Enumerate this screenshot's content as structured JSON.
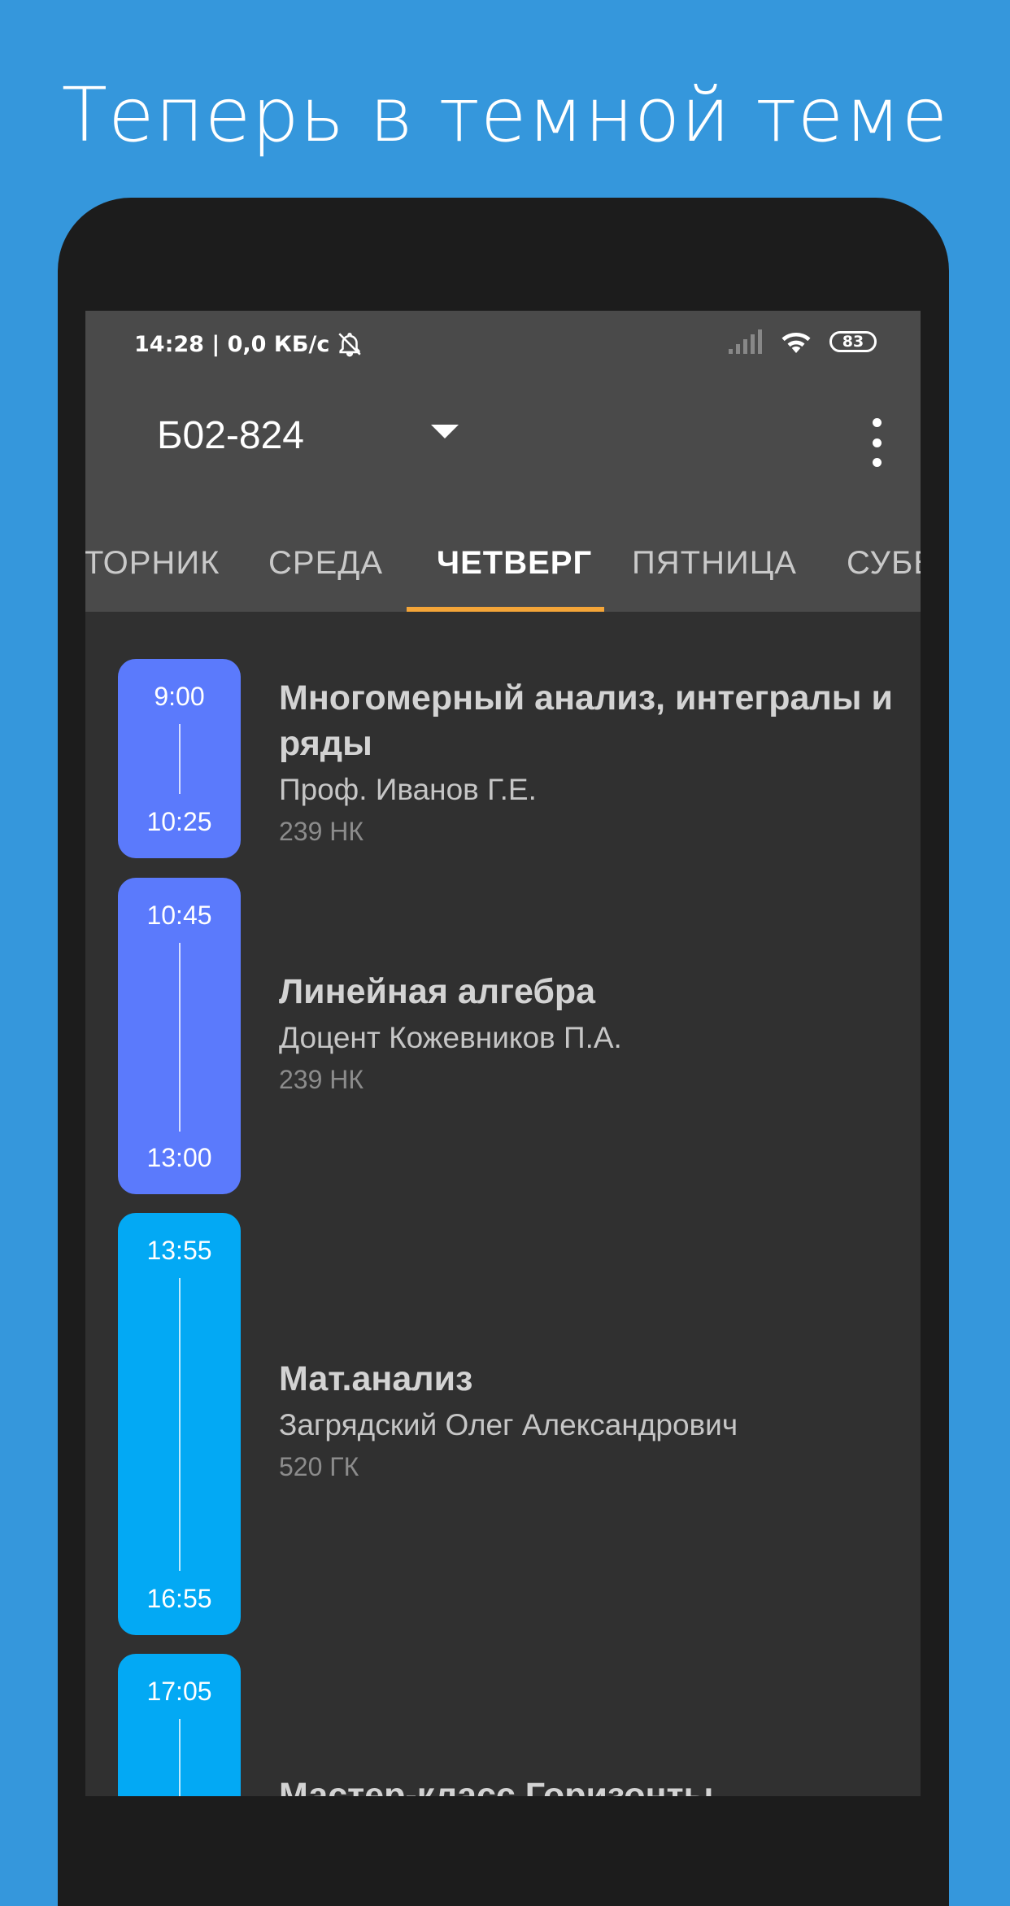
{
  "promo": {
    "title": "Теперь в темной теме"
  },
  "status_bar": {
    "time_speed": "14:28 | 0,0 КБ/с",
    "battery": "83"
  },
  "toolbar": {
    "group": "Б02-824"
  },
  "tabs": [
    {
      "label": "ТОРНИК"
    },
    {
      "label": "СРЕДА"
    },
    {
      "label": "ЧЕТВЕРГ"
    },
    {
      "label": "ПЯТНИЦА"
    },
    {
      "label": "СУББ"
    }
  ],
  "lessons": [
    {
      "start": "9:00",
      "end": "10:25",
      "title": "Многомерный анализ, интегралы и ряды",
      "teacher": "Проф. Иванов Г.Е.",
      "room": "239 НК",
      "color": "#5b7afc"
    },
    {
      "start": "10:45",
      "end": "13:00",
      "title": "Линейная алгебра",
      "teacher": "Доцент Кожевников П.А.",
      "room": "239 НК",
      "color": "#5b7afc"
    },
    {
      "start": "13:55",
      "end": "16:55",
      "title": "Мат.анализ",
      "teacher": "Загрядский Олег Александрович",
      "room": "520 ГК",
      "color": "#03a9f4"
    },
    {
      "start": "17:05",
      "end": "",
      "title": "Мастер-класс Горизонты",
      "teacher": "",
      "room": "",
      "color": "#03a9f4"
    }
  ],
  "colors": {
    "background": "#3597dc",
    "appbar": "#4a4a4a",
    "content": "#303030",
    "tab_indicator": "#f4a538"
  }
}
